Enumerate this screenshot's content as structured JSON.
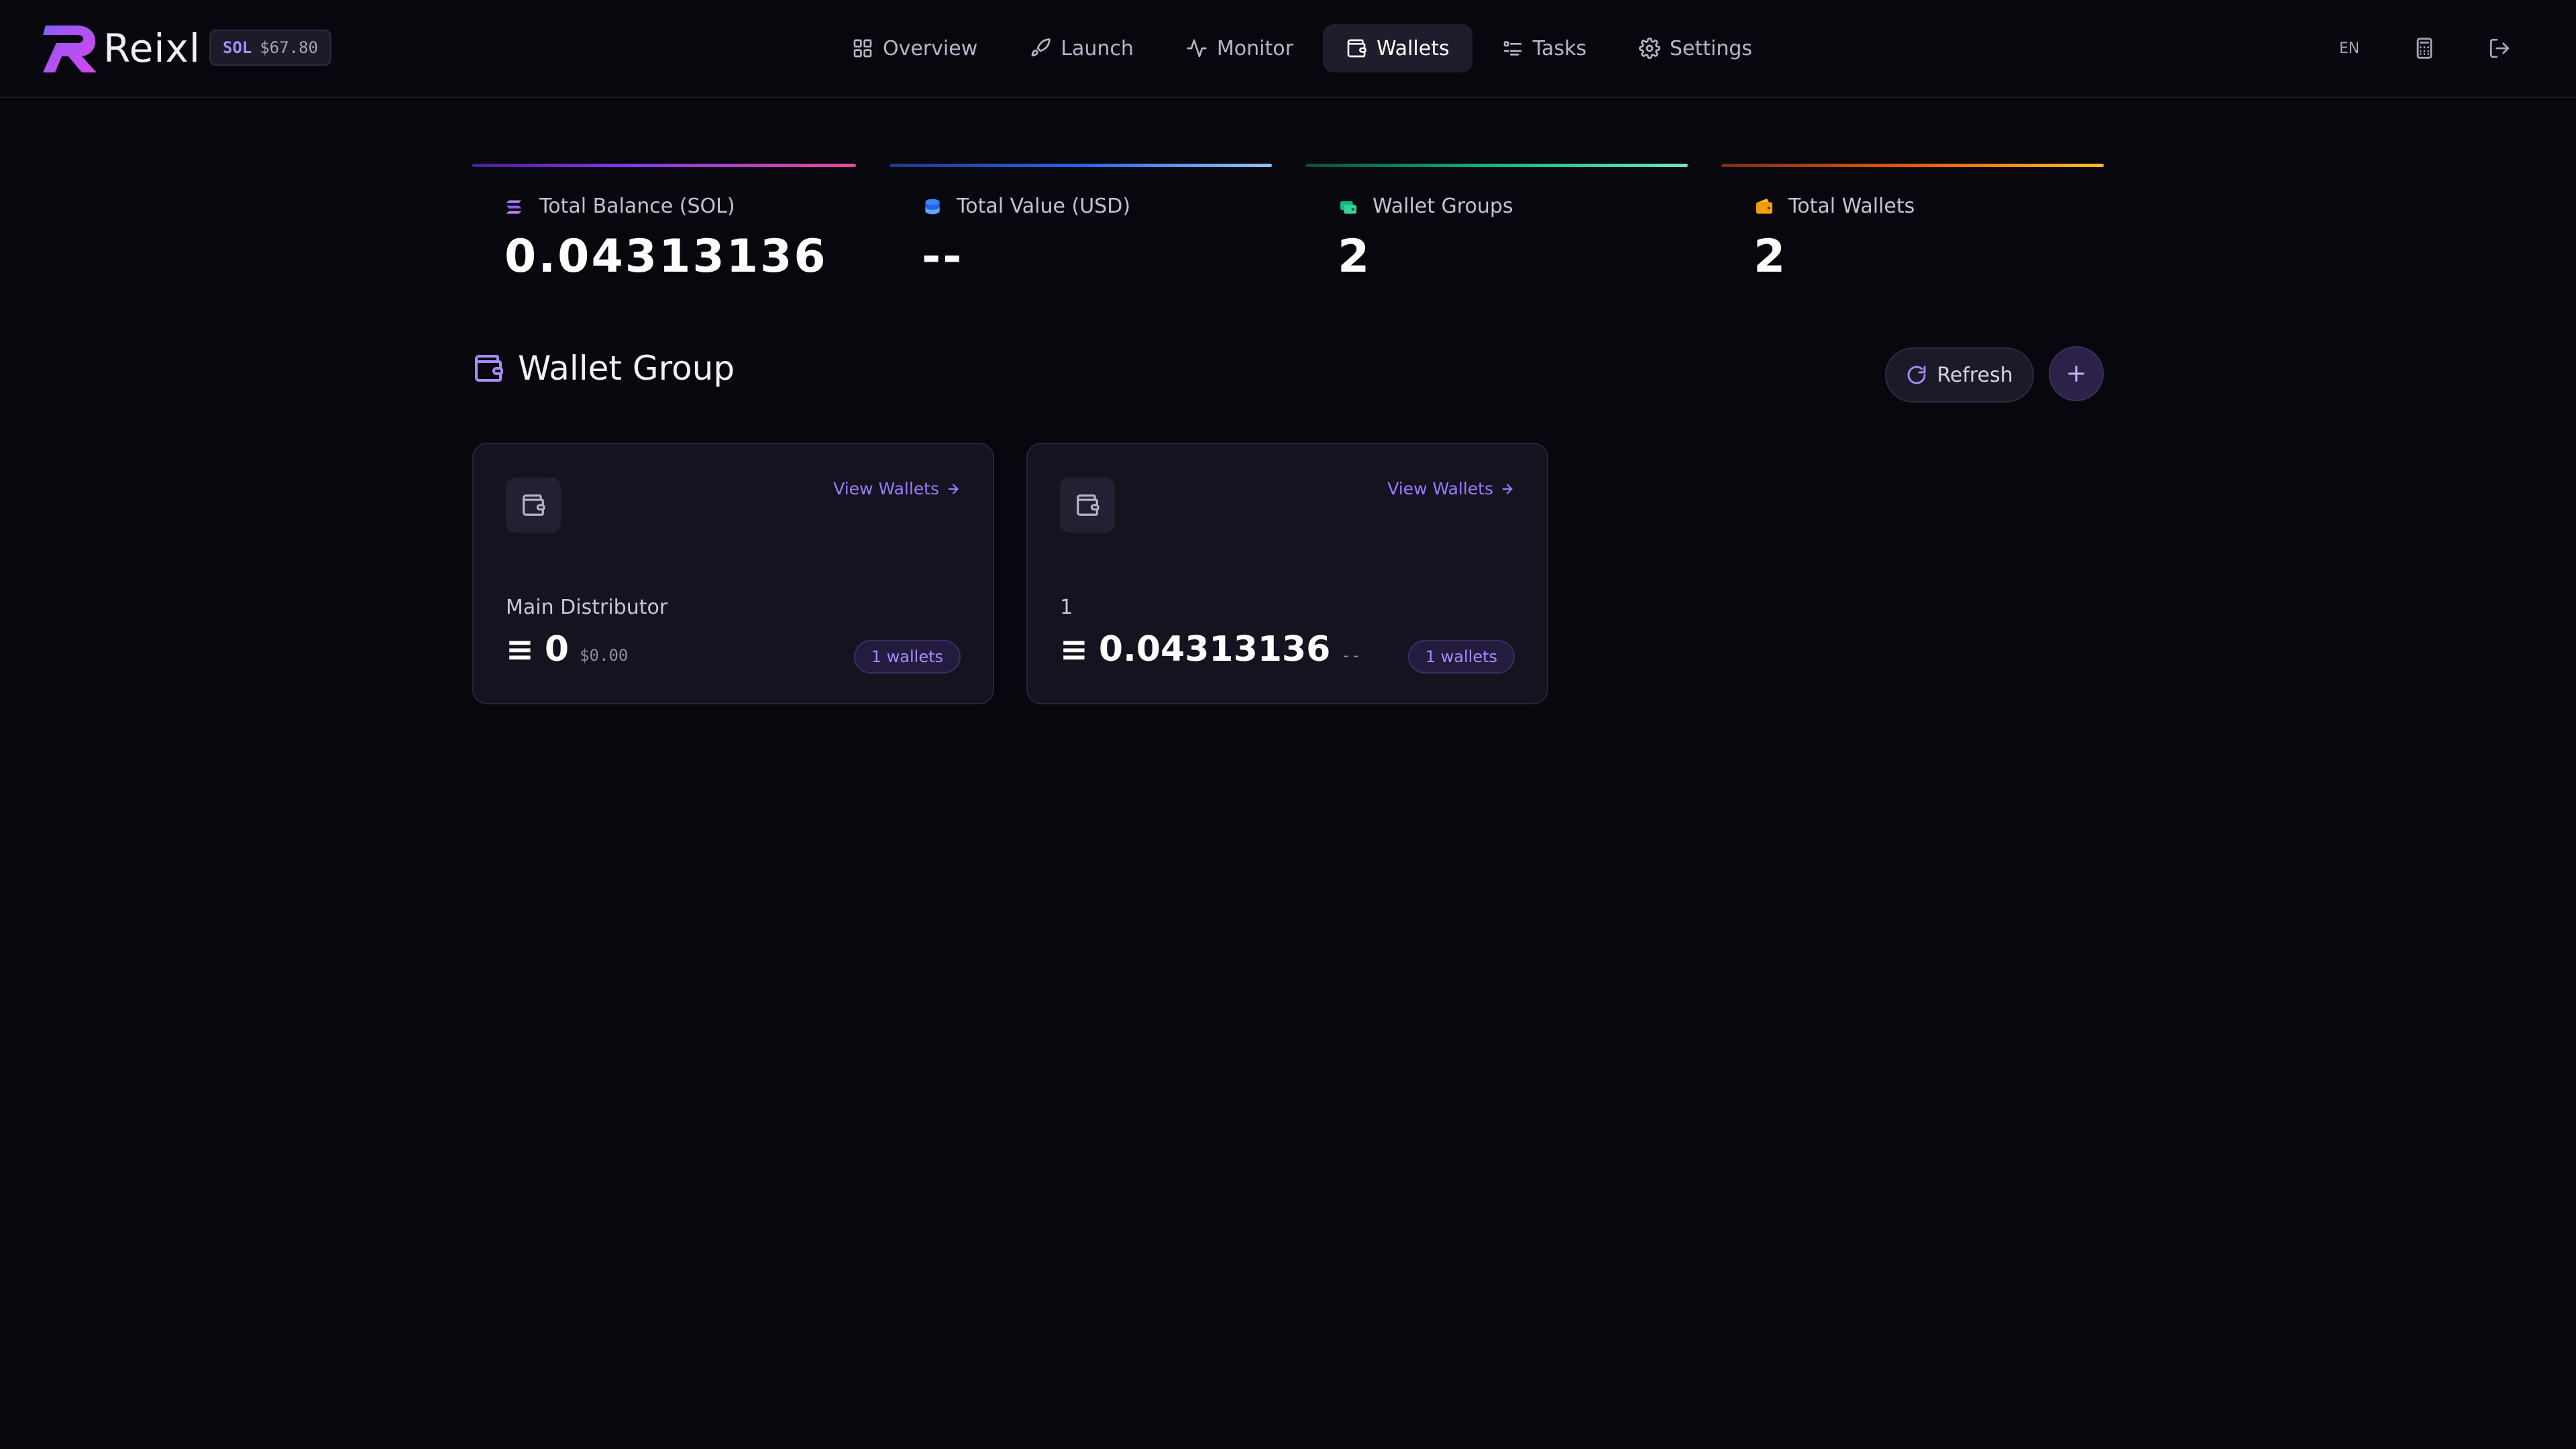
{
  "app": {
    "name": "Reixl",
    "sol_price": {
      "label": "SOL",
      "value": "$67.80"
    }
  },
  "nav": {
    "items": [
      {
        "label": "Overview",
        "icon": "grid-icon"
      },
      {
        "label": "Launch",
        "icon": "rocket-icon"
      },
      {
        "label": "Monitor",
        "icon": "activity-icon"
      },
      {
        "label": "Wallets",
        "icon": "wallet-icon",
        "active": true
      },
      {
        "label": "Tasks",
        "icon": "list-icon"
      },
      {
        "label": "Settings",
        "icon": "gear-icon"
      }
    ]
  },
  "header_right": {
    "language": "EN",
    "calculator_icon": "calculator-icon",
    "logout_icon": "logout-icon"
  },
  "stats": [
    {
      "label": "Total Balance (SOL)",
      "value": "0.04313136",
      "icon": "solana-icon",
      "gradient": [
        "#7c3aed",
        "#ec4899"
      ]
    },
    {
      "label": "Total Value (USD)",
      "value": "--",
      "icon": "coins-icon",
      "gradient": [
        "#2563eb",
        "#60a5fa"
      ]
    },
    {
      "label": "Wallet Groups",
      "value": "2",
      "icon": "groups-icon",
      "gradient": [
        "#10b981",
        "#34d399"
      ]
    },
    {
      "label": "Total Wallets",
      "value": "2",
      "icon": "wallet-icon",
      "gradient": [
        "#ea580c",
        "#fbbf24"
      ]
    }
  ],
  "section": {
    "title": "Wallet Group",
    "refresh_label": "Refresh"
  },
  "groups": [
    {
      "name": "Main Distributor",
      "balance": "0",
      "usd": "$0.00",
      "count_label": "1 wallets",
      "view_label": "View Wallets"
    },
    {
      "name": "1",
      "balance": "0.04313136",
      "usd": "--",
      "count_label": "1 wallets",
      "view_label": "View Wallets"
    }
  ],
  "colors": {
    "background": "#08070d",
    "accent": "#9b7bff",
    "card": "#15131f"
  }
}
